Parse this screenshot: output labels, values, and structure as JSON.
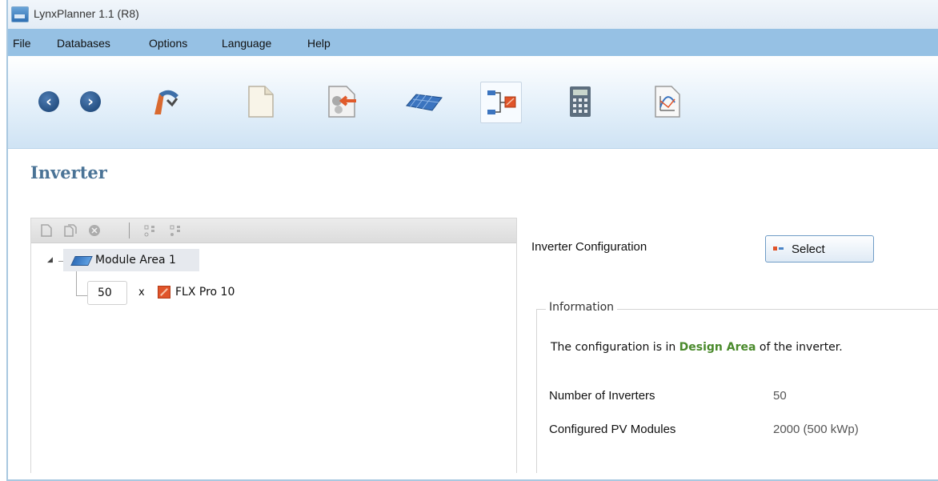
{
  "window": {
    "title": "LynxPlanner 1.1 (R8)"
  },
  "menu": [
    {
      "label": "File"
    },
    {
      "label": "Databases"
    },
    {
      "label": "Options"
    },
    {
      "label": "Language"
    },
    {
      "label": "Help"
    }
  ],
  "toolbar_icons": [
    "back-arrow-icon",
    "forward-arrow-icon",
    "run-wizard-icon",
    "document-icon",
    "import-icon",
    "solar-panel-icon",
    "inverter-configuration-icon",
    "calculator-icon",
    "chart-report-icon"
  ],
  "page": {
    "title": "Inverter"
  },
  "tree": {
    "root": {
      "label": "Module Area 1"
    },
    "child": {
      "quantity": "50",
      "times": "x",
      "label": "FLX Pro 10"
    }
  },
  "config": {
    "label": "Inverter Configuration",
    "select_label": "Select"
  },
  "information": {
    "legend": "Information",
    "text_before": "The configuration is in ",
    "text_highlight": "Design Area",
    "text_after": " of the inverter.",
    "rows": [
      {
        "label": "Number of Inverters",
        "value": "50"
      },
      {
        "label": "Configured PV Modules",
        "value": "2000 (500 kWp)"
      }
    ]
  },
  "colors": {
    "menubar": "#96c1e4",
    "page_title": "#4a7396",
    "highlight_text": "#4a8a2c"
  }
}
